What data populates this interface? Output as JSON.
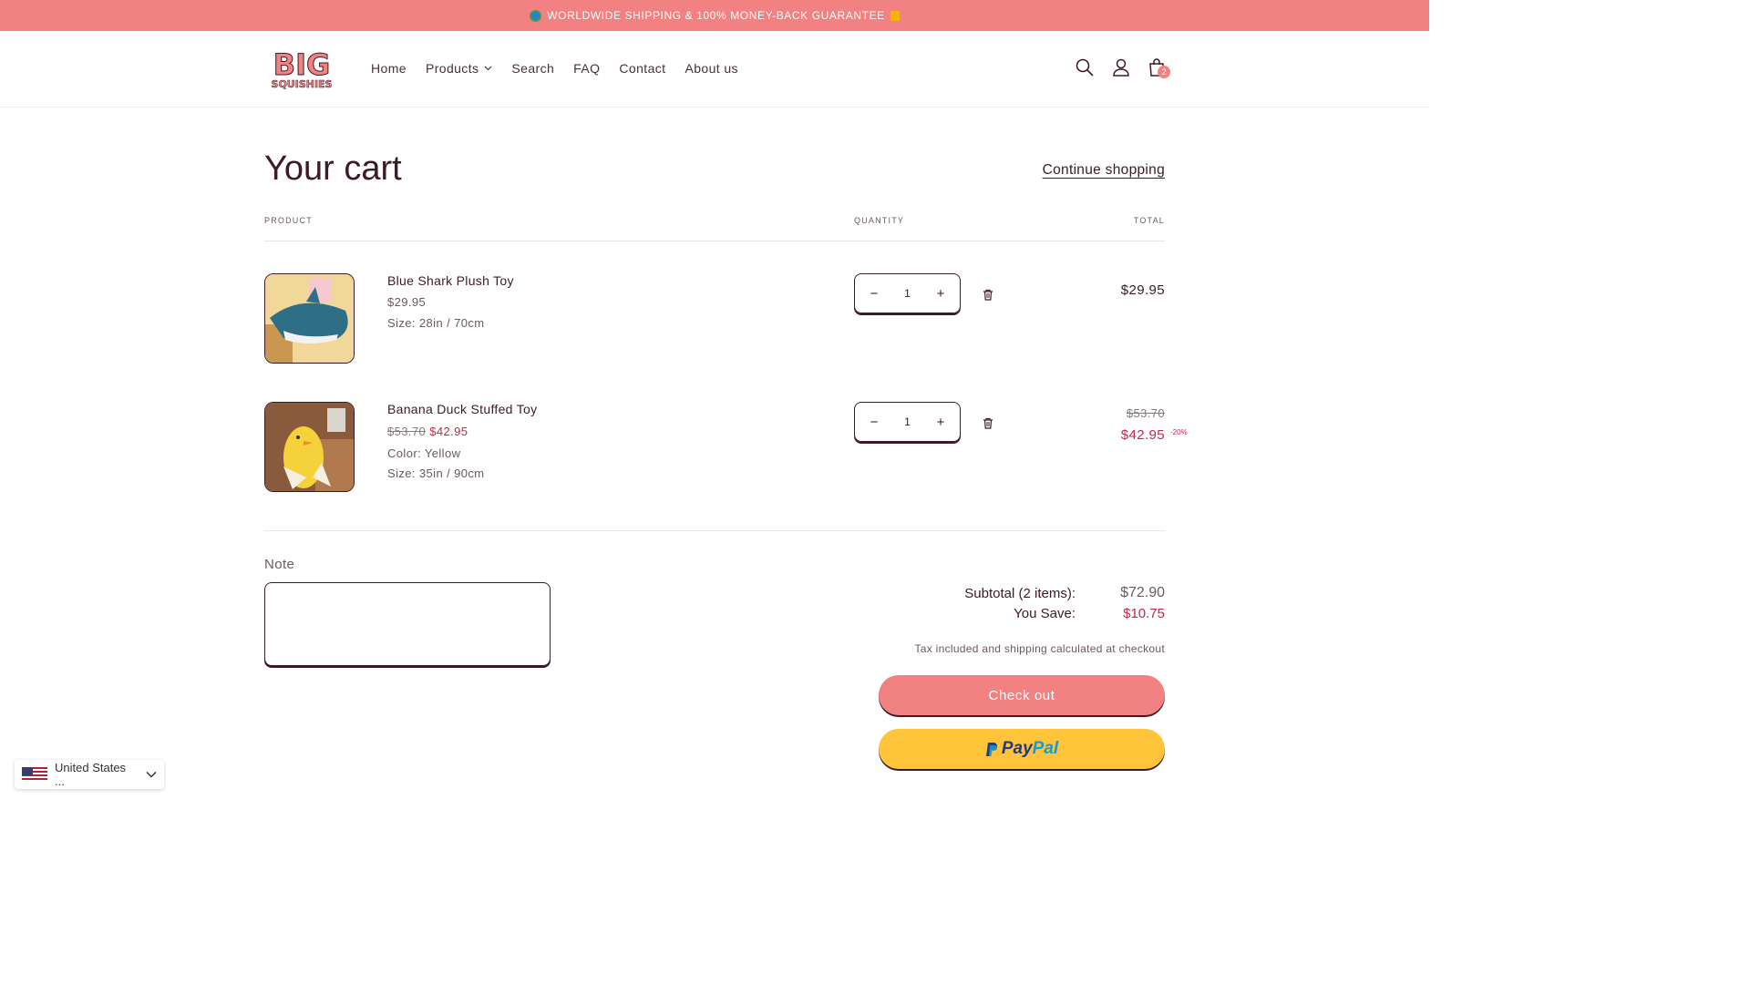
{
  "announcement": {
    "text": "WORLDWIDE SHIPPING & 100% MONEY-BACK GUARANTEE"
  },
  "brand": {
    "logo_line1": "BIG",
    "logo_line2": "SQUISHIES",
    "accent": "#f28282",
    "text_dark": "#3d1a24",
    "sale": "#c2274b"
  },
  "nav": {
    "items": [
      "Home",
      "Products",
      "Search",
      "FAQ",
      "Contact",
      "About us"
    ]
  },
  "cart_count": "2",
  "page": {
    "title": "Your cart",
    "continue_label": "Continue shopping"
  },
  "table": {
    "col_product": "PRODUCT",
    "col_quantity": "QUANTITY",
    "col_total": "TOTAL"
  },
  "items": [
    {
      "name": "Blue Shark Plush Toy",
      "price": "$29.95",
      "options": [
        "Size: 28in / 70cm"
      ],
      "quantity": "1",
      "total": "$29.95"
    },
    {
      "name": "Banana Duck Stuffed Toy",
      "compare_price": "$53.70",
      "price": "$42.95",
      "options": [
        "Color: Yellow",
        "Size: 35in / 90cm"
      ],
      "quantity": "1",
      "total_compare": "$53.70",
      "total": "$42.95",
      "discount_badge": "-20%"
    }
  ],
  "note": {
    "label": "Note"
  },
  "summary": {
    "subtotal_label": "Subtotal (2 items):",
    "subtotal_value": "$72.90",
    "save_label": "You Save:",
    "save_value": "$10.75",
    "tax_note": "Tax included and shipping calculated at checkout",
    "checkout_label": "Check out",
    "paypal_label_1": "Pay",
    "paypal_label_2": "Pal"
  },
  "country_selector": {
    "value": "United States ..."
  }
}
